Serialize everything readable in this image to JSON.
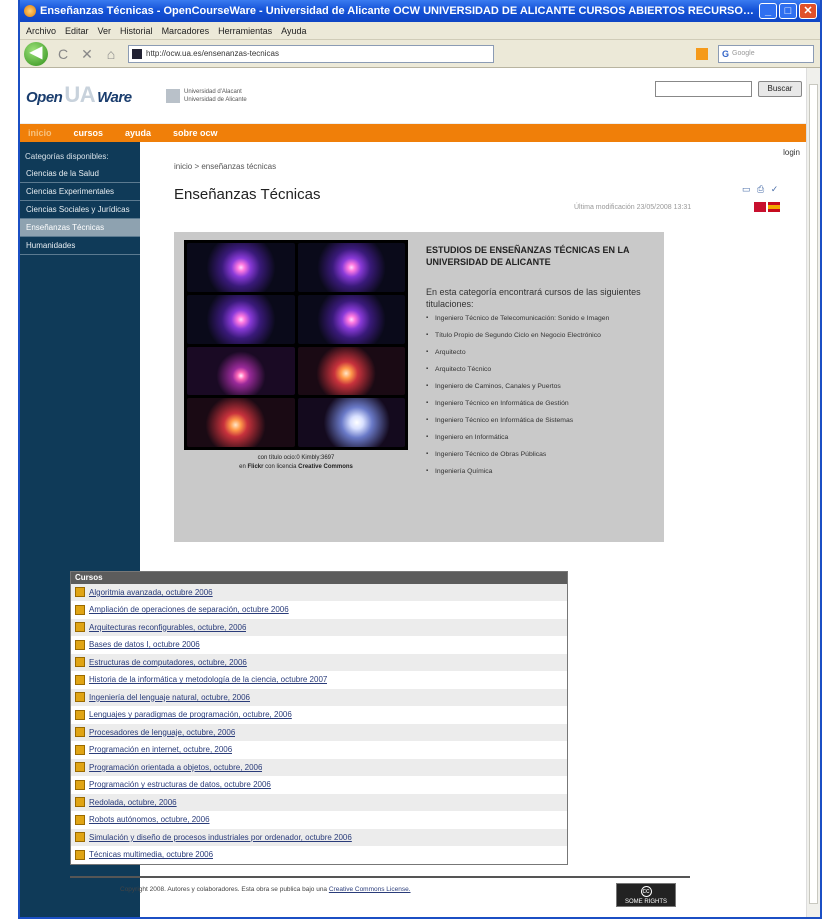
{
  "window": {
    "title": "Enseñanzas Técnicas - OpenCourseWare - Universidad de Alicante OCW UNIVERSIDAD DE ALICANTE CURSOS ABIERTOS RECURSOS EDUCATIVO...",
    "minimize": "_",
    "maximize": "□",
    "close": "✕"
  },
  "menubar": [
    "Archivo",
    "Editar",
    "Ver",
    "Historial",
    "Marcadores",
    "Herramientas",
    "Ayuda"
  ],
  "navbar": {
    "back": "◀",
    "reload": "C",
    "stop": "✕",
    "home": "⌂",
    "url": "http://ocw.ua.es/ensenanzas-tecnicas",
    "search_engine": "G",
    "search_placeholder": "Google"
  },
  "header": {
    "logo_open": "Open",
    "logo_ua": "UA",
    "logo_ware": "Ware",
    "uni_line1": "Universidad d'Alacant",
    "uni_line2": "Universidad de Alicante",
    "search_button": "Buscar"
  },
  "orange_nav": [
    "inicio",
    "cursos",
    "ayuda",
    "sobre ocw"
  ],
  "sidebar": {
    "heading": "Categorías disponibles:",
    "items": [
      "Ciencias de la Salud",
      "Ciencias Experimentales",
      "Ciencias Sociales y Jurídicas",
      "Enseñanzas Técnicas",
      "Humanidades"
    ]
  },
  "main": {
    "login": "login",
    "breadcrumb": "inicio > enseñanzas técnicas",
    "title": "Enseñanzas Técnicas",
    "tools": "▭ ⎙ ✓",
    "last_modified": "Última modificación 23/05/2008 13:31",
    "feature": {
      "credit_line1": "con título ocio:0 Kimbly:3697",
      "credit_line2_a": "en ",
      "credit_line2_b": "Flickr",
      "credit_line2_c": " con licencia ",
      "credit_line2_d": "Creative Commons",
      "heading": "ESTUDIOS DE ENSEÑANZAS TÉCNICAS EN LA UNIVERSIDAD DE ALICANTE",
      "intro": "En esta categoría encontrará cursos de las siguientes titulaciones:",
      "degrees": [
        "Ingeniero Técnico de Telecomunicación: Sonido e Imagen",
        "Título Propio de Segundo Ciclo en Negocio Electrónico",
        "Arquitecto",
        "Arquitecto Técnico",
        "Ingeniero de Caminos, Canales y Puertos",
        "Ingeniero Técnico en Informática de Gestión",
        "Ingeniero Técnico en Informática de Sistemas",
        "Ingeniero en Informática",
        "Ingeniero Técnico de Obras Públicas",
        "Ingeniería Química"
      ]
    },
    "courses": {
      "heading": "Cursos",
      "items": [
        "Algoritmia avanzada, octubre 2006",
        "Ampliación de operaciones de separación, octubre 2006",
        "Arquitecturas reconfigurables, octubre, 2006",
        "Bases de datos I, octubre 2006",
        "Estructuras de computadores, octubre, 2006",
        "Historia de la informática y metodología de la ciencia, octubre 2007",
        "Ingeniería del lenguaje natural, octubre, 2006",
        "Lenguajes y paradigmas de programación, octubre, 2006",
        "Procesadores de lenguaje, octubre, 2006",
        "Programación en internet, octubre, 2006",
        "Programación orientada a objetos, octubre, 2006",
        "Programación y estructuras de datos, octubre 2006",
        "Redolada, octubre, 2006",
        "Robots autónomos, octubre, 2006",
        "Simulación y diseño de procesos industriales por ordenador, octubre 2006",
        "Técnicas multimedia, octubre 2006"
      ]
    }
  },
  "footer": {
    "text": "Copyright 2008. Autores y colaboradores. Esta obra se publica bajo una ",
    "link": "Creative Commons License.",
    "cc_symbol": "cc",
    "cc_label": "SOME RIGHTS RESERVED"
  }
}
